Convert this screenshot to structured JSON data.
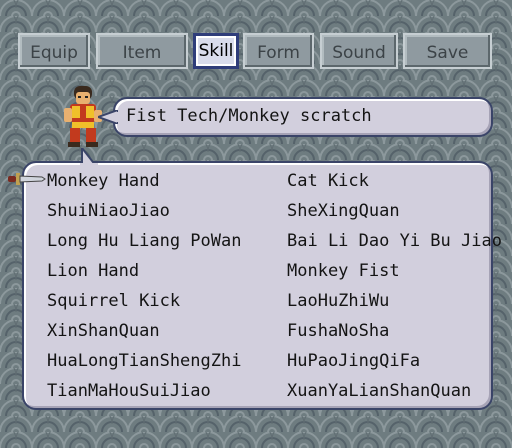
{
  "menu": {
    "items": [
      {
        "label": "Equip",
        "active": false
      },
      {
        "label": "Item",
        "active": false
      },
      {
        "label": "Skill",
        "active": true
      },
      {
        "label": "Form",
        "active": false
      },
      {
        "label": "Sound",
        "active": false
      },
      {
        "label": "Save",
        "active": false
      }
    ]
  },
  "description": "Fist Tech/Monkey scratch",
  "skills": {
    "left": [
      "Monkey Hand",
      "ShuiNiaoJiao",
      "Long Hu Liang PoWan",
      "Lion Hand",
      "Squirrel Kick",
      "XinShanQuan",
      "HuaLongTianShengZhi",
      "TianMaHouSuiJiao"
    ],
    "right": [
      "Cat Kick",
      "SheXingQuan",
      "Bai Li Dao Yi Bu Jiao",
      "Monkey Fist",
      "LaoHuZhiWu",
      "FushaNoSha",
      "HuPaoJingQiFa",
      "XuanYaLianShanQuan"
    ],
    "selected": "Monkey Hand"
  },
  "icons": {
    "character": "monk-character-sprite-icon",
    "cursor": "sword-pointer-icon"
  },
  "colors": {
    "background": "#6e7c80",
    "panel": "#d2cfdd",
    "panel_border": "#3a4468",
    "button": "#8f9aa0",
    "button_active": "#d9dcec"
  }
}
